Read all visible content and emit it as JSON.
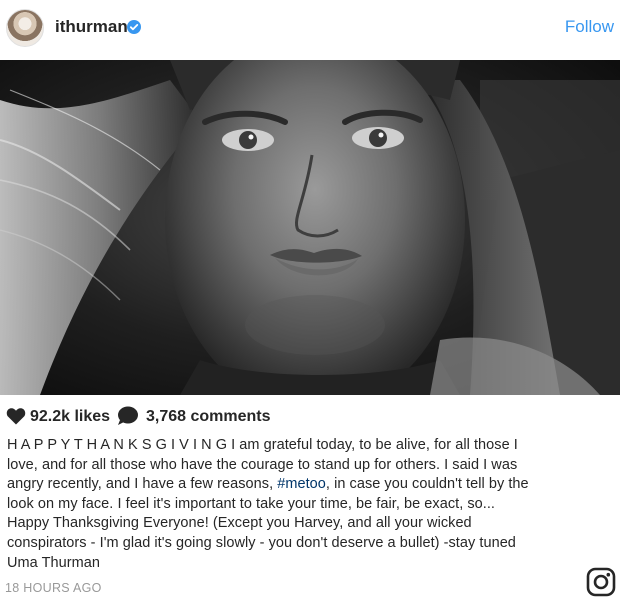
{
  "header": {
    "username": "ithurman",
    "follow_label": "Follow"
  },
  "engagement": {
    "likes": "92.2k likes",
    "comments": "3,768 comments"
  },
  "caption": {
    "line1": "H A P P Y T H A N K S G I V I N G I am grateful today, to be alive, for all those I",
    "line2": "love, and for all those who have the courage to stand up for others. I said I was",
    "line3_pre": "angry recently, and I have a few reasons, ",
    "hashtag": "#metoo",
    "line3_post": ", in case you couldn't tell by the",
    "line4": "look on my face. I feel it's important to take your time, be fair, be exact, so...",
    "line5": "Happy Thanksgiving Everyone! (Except you Harvey, and all your wicked",
    "line6": "conspirators - I'm glad it's going slowly - you don't deserve a bullet) -stay tuned",
    "line7": "Uma Thurman"
  },
  "timestamp": "18 HOURS AGO",
  "icons": {
    "verified": "verified-badge-icon",
    "heart": "heart-icon",
    "comment": "comment-icon",
    "instagram": "instagram-logo-icon"
  },
  "colors": {
    "link": "#3897f0",
    "hashtag": "#003569",
    "verified": "#3897f0",
    "text": "#262626",
    "muted": "#999999"
  }
}
